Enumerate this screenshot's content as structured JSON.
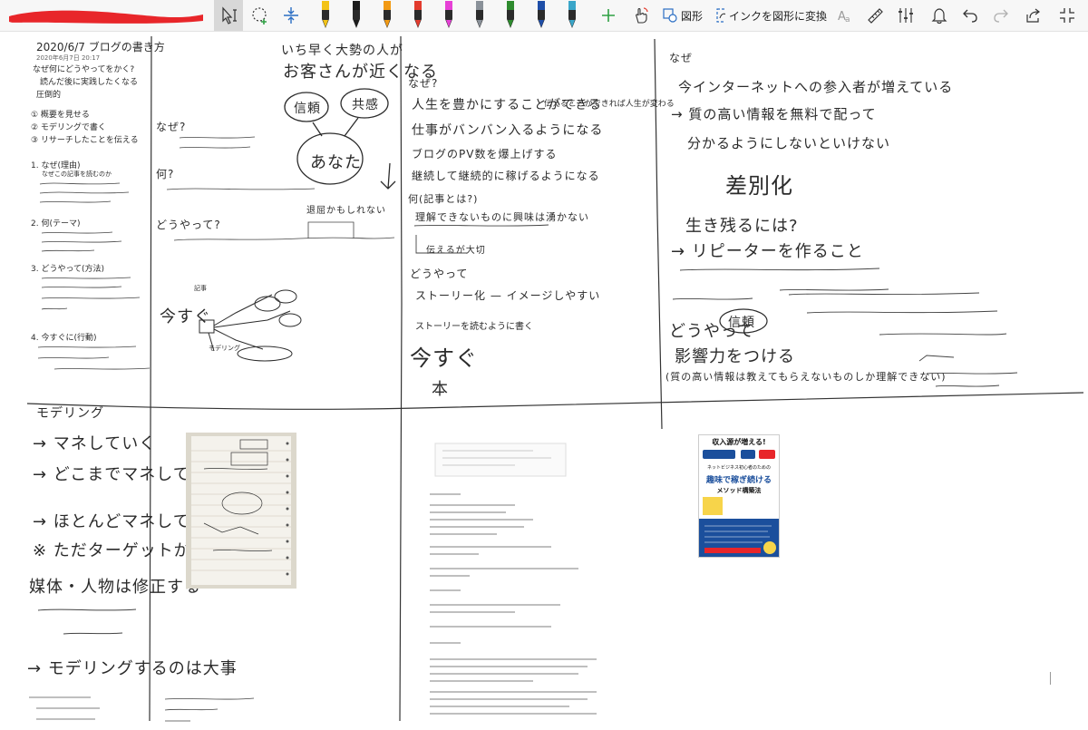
{
  "colors": {
    "title_marker": "#e8262a",
    "toolbar_bg": "#f7f7f7",
    "add_plus": "#2ea043",
    "icon_blue": "#2a6ec4",
    "ink": "#2b2b2b",
    "book_cover_blue": "#1b4f9c"
  },
  "toolbar": {
    "title_marker_icon": "redacted-title-marker",
    "pens": [
      {
        "icon": "pen-icon",
        "color": "#f3c316"
      },
      {
        "icon": "pen-icon",
        "color": "#1c1c1c"
      },
      {
        "icon": "pen-icon",
        "color": "#f29a13"
      },
      {
        "icon": "pen-icon",
        "color": "#e23b2e"
      },
      {
        "icon": "highlighter-icon",
        "color": "#e640d6"
      },
      {
        "icon": "pen-icon",
        "color": "#8a9199"
      },
      {
        "icon": "pen-icon",
        "color": "#2e8b2e"
      },
      {
        "icon": "pen-icon",
        "color": "#1e4ea8"
      },
      {
        "icon": "pen-icon",
        "color": "#3aa6c9"
      }
    ],
    "shapes_label": "図形",
    "ink_to_shape_label": "インクを図形に変換"
  },
  "notes": {
    "col1": {
      "title": "2020/6/7 ブログの書き方",
      "date_small": "2020年6月7日    20:17",
      "lines": [
        "なぜ何にどうやってをかく?",
        "読んだ後に実践したくなる",
        "圧倒的",
        "① 概要を見せる",
        "② モデリングで書く",
        "③ リサーチしたことを伝える",
        "1. なぜ(理由)",
        "なぜこの記事を読むのか",
        "2. 何(テーマ)",
        "3. どうやって(方法)",
        "4. 今すぐに(行動)"
      ]
    },
    "col2": {
      "top_lines": [
        "いち早く大勢の人が",
        "お客さんが近くなる"
      ],
      "bubble_left": "信頼",
      "bubble_right": "共感",
      "bubble_center": "あなた",
      "naze": "なぜ?",
      "nani": "何?",
      "douyatte": "どうやって?",
      "ima": "今すぐ",
      "box_label": "退屈かもしれない",
      "label_mini_a": "記事",
      "label_mini_b": "モデリング"
    },
    "col3": {
      "naze": "なぜ?",
      "lines": [
        "人生を豊かにすることができる",
        "仕事がバンバン入るようになる",
        "ブログのPV数を爆上げする",
        "継続して継続的に稼げるようになる"
      ],
      "side_note": "伝えることができれば人生が変わる",
      "nani": "何(記事とは?)",
      "nani_lines": [
        "理解できないものに興味は湧かない",
        "伝えるが大切"
      ],
      "douyatte": "どうやって",
      "story": "ストーリー化 — イメージしやすい",
      "story_sub": "ストーリーを読むように書く",
      "ima": "今すぐ",
      "hon": "本"
    },
    "col4": {
      "naze": "なぜ",
      "lines": [
        "今インターネットへの参入者が増えている",
        "→ 質の高い情報を無料で配って",
        "分かるようにしないといけない"
      ],
      "sabetsuka": "差別化",
      "ikinokoru": "生き残るには?",
      "repeater": "→ リピーターを作ること",
      "douyatte": "どうやって",
      "shinrai": "信頼",
      "eikyou": "影響力をつける",
      "quality_note": "(質の高い情報は教えてもらえないものしか理解できない)"
    },
    "bottom": {
      "modeling_title": "モデリング",
      "lines": [
        "→ マネしていく",
        "→ どこまでマネしていいのか?",
        "→ ほとんどマネして良い",
        "※ ただターゲットが違う",
        "媒体・人物は修正する",
        "→ モデリングするのは大事"
      ]
    },
    "book": {
      "banner": "収入源が増える!",
      "subtitle": "ネットビジネス初心者のための",
      "title": "趣味で稼ぎ続ける",
      "title2": "メソッド構築法"
    }
  }
}
